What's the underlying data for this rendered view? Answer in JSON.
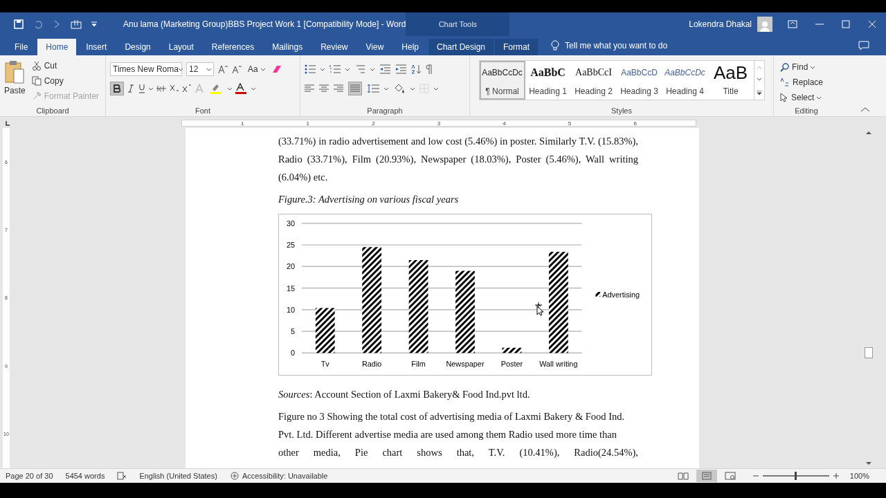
{
  "window": {
    "title": "Anu lama (Marketing Group)BBS Project Work 1 [Compatibility Mode]  -  Word",
    "context_group": "Chart Tools",
    "user": "Lokendra Dhakal"
  },
  "ribbon_tabs": [
    {
      "label": "File",
      "selected": false,
      "kind": "plain"
    },
    {
      "label": "Home",
      "selected": true,
      "kind": "plain"
    },
    {
      "label": "Insert",
      "selected": false,
      "kind": "plain"
    },
    {
      "label": "Design",
      "selected": false,
      "kind": "plain"
    },
    {
      "label": "Layout",
      "selected": false,
      "kind": "plain"
    },
    {
      "label": "References",
      "selected": false,
      "kind": "plain"
    },
    {
      "label": "Mailings",
      "selected": false,
      "kind": "plain"
    },
    {
      "label": "Review",
      "selected": false,
      "kind": "plain"
    },
    {
      "label": "View",
      "selected": false,
      "kind": "plain"
    },
    {
      "label": "Help",
      "selected": false,
      "kind": "plain"
    },
    {
      "label": "Chart Design",
      "selected": false,
      "kind": "context"
    },
    {
      "label": "Format",
      "selected": false,
      "kind": "context"
    }
  ],
  "tell_me": "Tell me what you want to do",
  "clipboard": {
    "paste": "Paste",
    "cut": "Cut",
    "copy": "Copy",
    "format_painter": "Format Painter",
    "label": "Clipboard"
  },
  "font": {
    "name": "Times New Roma",
    "size": "12",
    "change_case": "Aa",
    "bold_on": true,
    "label": "Font"
  },
  "paragraph": {
    "label": "Paragraph",
    "justify_on": true
  },
  "styles": {
    "label": "Styles",
    "items": [
      {
        "preview": "AaBbCcDc",
        "name": "¶ Normal",
        "selected": true,
        "kind": "normal"
      },
      {
        "preview": "AaBbC",
        "name": "Heading 1",
        "selected": false,
        "kind": "h1"
      },
      {
        "preview": "AaBbCcI",
        "name": "Heading 2",
        "selected": false,
        "kind": "h2"
      },
      {
        "preview": "AaBbCcD",
        "name": "Heading 3",
        "selected": false,
        "kind": "h3"
      },
      {
        "preview": "AaBbCcDc",
        "name": "Heading 4",
        "selected": false,
        "kind": "h4"
      },
      {
        "preview": "AaB",
        "name": "Title",
        "selected": false,
        "kind": "title"
      }
    ]
  },
  "editing": {
    "find": "Find",
    "replace": "Replace",
    "select": "Select",
    "label": "Editing"
  },
  "ruler": {
    "numbers": [
      "1",
      "1",
      "2",
      "3",
      "4",
      "5",
      "6"
    ]
  },
  "vertical_ruler": {
    "numbers": [
      "6",
      "7",
      "8",
      "9",
      "10"
    ]
  },
  "document": {
    "intro": "(33.71%) in radio advertisement and low cost (5.46%) in poster. Similarly T.V. (15.83%), Radio (33.71%), Film (20.93%), Newspaper (18.03%), Poster (5.46%), Wall writing (6.04%) etc.",
    "caption": "Figure.3: Advertising on various fiscal years",
    "chart_data": {
      "type": "bar",
      "categories": [
        "Tv",
        "Radio",
        "Film",
        "Newspaper",
        "Poster",
        "Wall writing"
      ],
      "series": [
        {
          "name": "Advertising",
          "color": "#000000",
          "values": [
            10.4,
            24.5,
            21.5,
            19.0,
            1.2,
            23.4
          ]
        }
      ],
      "grid": true,
      "ylim": [
        0,
        30
      ],
      "yticks": [
        0,
        5,
        10,
        15,
        20,
        25,
        30
      ]
    },
    "source": "*Sources*: Account Section of Laxmi Bakery& Food Ind.pvt ltd.",
    "body_lines": [
      "Figure no 3 Showing the total cost of advertising media of Laxmi Bakery & Food Ind.",
      "Pvt. Ltd. Different advertise media are used among them Radio used more time than",
      "other media, Pie chart shows that, T.V. (10.41%), Radio(24.54%),"
    ]
  },
  "status_bar": {
    "page": "Page 20 of 30",
    "words": "5454 words",
    "language": "English (United States)",
    "accessibility": "Accessibility: Unavailable",
    "zoom": "100%",
    "zoom_level": {
      "level": 0.5
    },
    "views": [
      {
        "kind": "read",
        "selected": false
      },
      {
        "kind": "print",
        "selected": true
      },
      {
        "kind": "web",
        "selected": false
      }
    ]
  }
}
